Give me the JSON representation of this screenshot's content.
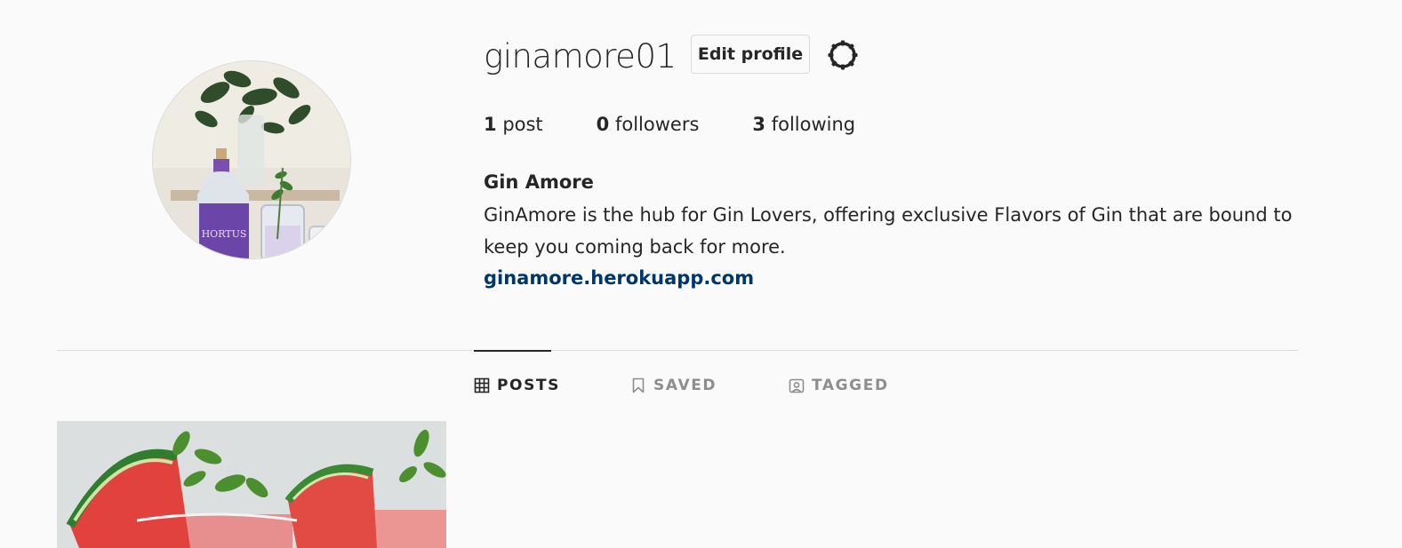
{
  "profile": {
    "username": "ginamore01",
    "edit_label": "Edit profile",
    "full_name": "Gin Amore",
    "bio": "GinAmore is the hub for Gin Lovers, offering exclusive Flavors of Gin that are bound to keep you coming back for more.",
    "website": "ginamore.herokuapp.com",
    "avatar_bottle_label": "HORTUS"
  },
  "stats": {
    "posts_count": "1",
    "posts_label": "post",
    "followers_count": "0",
    "followers_label": "followers",
    "following_count": "3",
    "following_label": "following"
  },
  "tabs": [
    {
      "label": "POSTS",
      "icon": "grid-icon",
      "active": true
    },
    {
      "label": "SAVED",
      "icon": "bookmark-icon",
      "active": false
    },
    {
      "label": "TAGGED",
      "icon": "tagged-icon",
      "active": false
    }
  ],
  "colors": {
    "background": "#fafafa",
    "text": "#262626",
    "link": "#00376b",
    "muted": "#8e8e8e",
    "border": "#dbdbdb"
  }
}
